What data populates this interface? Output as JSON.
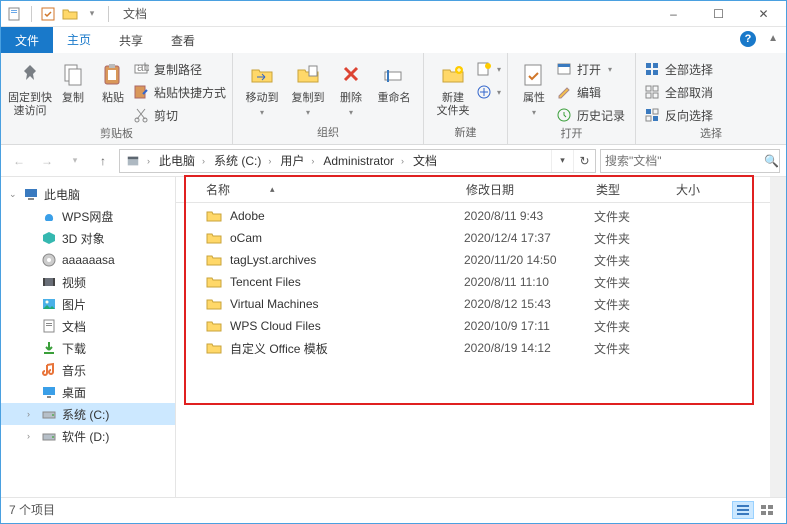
{
  "window": {
    "title": "文档"
  },
  "tabs": {
    "file": "文件",
    "home": "主页",
    "share": "共享",
    "view": "查看"
  },
  "ribbon": {
    "pin": "固定到快\n速访问",
    "copy": "复制",
    "paste": "粘贴",
    "cut": "剪切",
    "copypath": "复制路径",
    "pasteshortcut": "粘贴快捷方式",
    "clipboard": "剪贴板",
    "moveto": "移动到",
    "copyto": "复制到",
    "delete": "删除",
    "rename": "重命名",
    "organize": "组织",
    "newfolder": "新建\n文件夹",
    "new": "新建",
    "properties": "属性",
    "open": "打开",
    "edit": "编辑",
    "history": "历史记录",
    "open_group": "打开",
    "selectall": "全部选择",
    "selectnone": "全部取消",
    "invert": "反向选择",
    "select": "选择"
  },
  "breadcrumb": [
    "此电脑",
    "系统 (C:)",
    "用户",
    "Administrator",
    "文档"
  ],
  "search": {
    "placeholder": "搜索\"文档\""
  },
  "sidebar": {
    "thispc": "此电脑",
    "wps": "WPS网盘",
    "obj3d": "3D 对象",
    "aaa": "aaaaaasa",
    "video": "视频",
    "pics": "图片",
    "docs": "文档",
    "down": "下载",
    "music": "音乐",
    "desk": "桌面",
    "cdrive": "系统 (C:)",
    "ddrive": "软件 (D:)"
  },
  "columns": {
    "name": "名称",
    "date": "修改日期",
    "type": "类型",
    "size": "大小"
  },
  "files": [
    {
      "name": "Adobe",
      "date": "2020/8/11 9:43",
      "type": "文件夹"
    },
    {
      "name": "oCam",
      "date": "2020/12/4 17:37",
      "type": "文件夹"
    },
    {
      "name": "tagLyst.archives",
      "date": "2020/11/20 14:50",
      "type": "文件夹"
    },
    {
      "name": "Tencent Files",
      "date": "2020/8/11 11:10",
      "type": "文件夹"
    },
    {
      "name": "Virtual Machines",
      "date": "2020/8/12 15:43",
      "type": "文件夹"
    },
    {
      "name": "WPS Cloud Files",
      "date": "2020/10/9 17:11",
      "type": "文件夹"
    },
    {
      "name": "自定义 Office 模板",
      "date": "2020/8/19 14:12",
      "type": "文件夹"
    }
  ],
  "status": "7 个项目"
}
